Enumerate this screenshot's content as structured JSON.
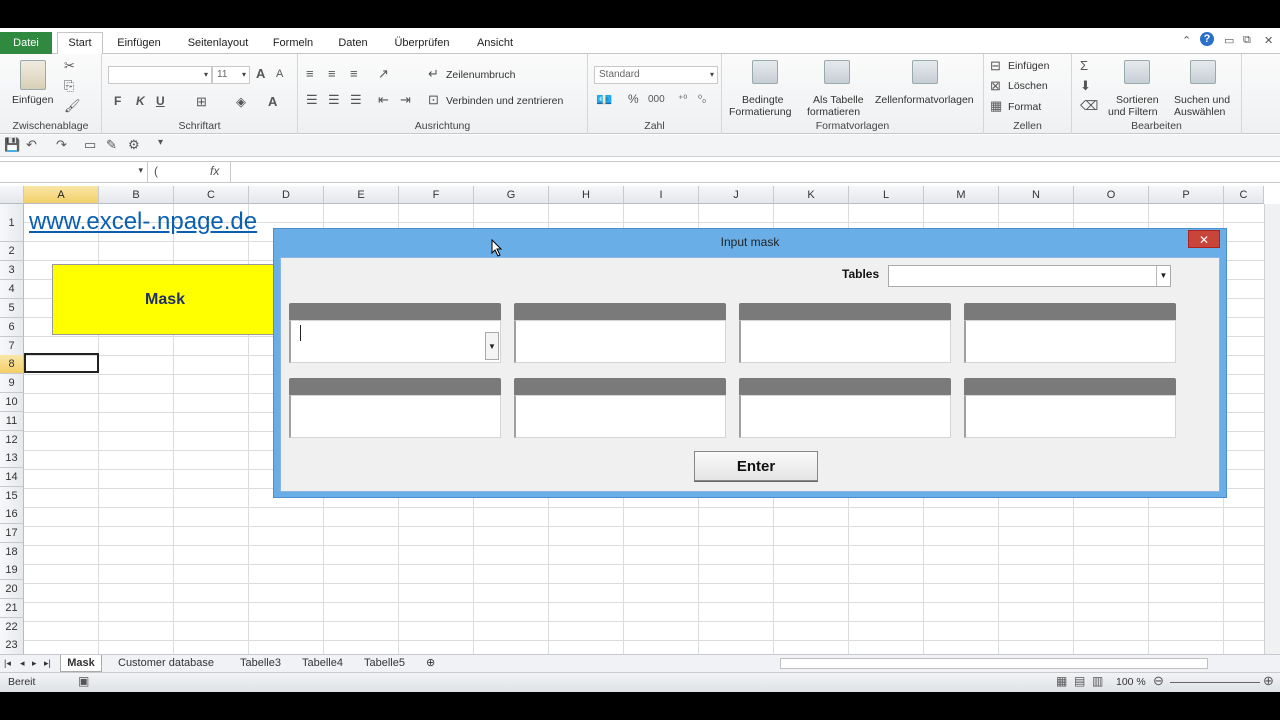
{
  "ribbon_tabs": [
    "Datei",
    "Start",
    "Einfügen",
    "Seitenlayout",
    "Formeln",
    "Daten",
    "Überprüfen",
    "Ansicht"
  ],
  "clipboard": {
    "paste": "Einfügen",
    "label": "Zwischenablage"
  },
  "font": {
    "size": "11",
    "bold": "F",
    "italic": "K",
    "underline": "U",
    "label": "Schriftart"
  },
  "alignment": {
    "wrap": "Zeilenumbruch",
    "merge": "Verbinden und zentrieren",
    "label": "Ausrichtung"
  },
  "number": {
    "format": "Standard",
    "label": "Zahl"
  },
  "styles": {
    "cond_line1": "Bedingte",
    "cond_line2": "Formatierung",
    "table_line1": "Als Tabelle",
    "table_line2": "formatieren",
    "cell": "Zellenformatvorlagen",
    "label": "Formatvorlagen"
  },
  "cells": {
    "insert": "Einfügen",
    "delete": "Löschen",
    "format": "Format",
    "label": "Zellen"
  },
  "editing": {
    "sort_line1": "Sortieren",
    "sort_line2": "und Filtern",
    "find_line1": "Suchen und",
    "find_line2": "Auswählen",
    "label": "Bearbeiten"
  },
  "formula_bar": {
    "fx": "fx"
  },
  "columns": [
    "A",
    "B",
    "C",
    "D",
    "E",
    "F",
    "G",
    "H",
    "I",
    "J",
    "K",
    "L",
    "M",
    "N",
    "O",
    "P",
    "C"
  ],
  "rows": [
    "1",
    "2",
    "3",
    "4",
    "5",
    "6",
    "7",
    "8",
    "9",
    "10",
    "11",
    "12",
    "13",
    "14",
    "15",
    "16",
    "17",
    "18",
    "19",
    "20",
    "21",
    "22",
    "23"
  ],
  "sheet": {
    "link": "www.excel-.npage.de",
    "mask_button": "Mask"
  },
  "sheet_tabs": [
    "Mask",
    "Customer database",
    "Tabelle3",
    "Tabelle4",
    "Tabelle5"
  ],
  "status": {
    "ready": "Bereit",
    "zoom": "100 %"
  },
  "dialog": {
    "title": "Input mask",
    "close": "✕",
    "tables_label": "Tables",
    "enter_button": "Enter"
  }
}
